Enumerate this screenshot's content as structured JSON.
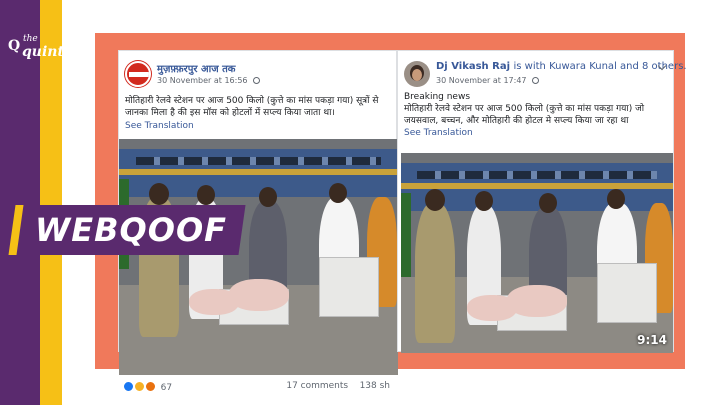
{
  "brand": {
    "logo_prefix": "the",
    "logo_name": "quint",
    "logo_mark": "Q"
  },
  "badge": {
    "label": "WEBQOOF"
  },
  "colors": {
    "purple": "#5a2a6e",
    "yellow": "#f6c016",
    "frame": "#f0795b",
    "fb_link": "#385898"
  },
  "posts": [
    {
      "author": "मुज़फ़्फ़रपुर आज तक",
      "timestamp": "30 November at 16:56",
      "text": "मोतिहारी रेलवे स्टेशन पर आज 500 किलो (कुत्ते का मांस पकड़ा गया) सूत्रों से जानका मिला है की इस मॉस को होटलों में सप्ल्य किया जाता था।",
      "translate_link": "See Translation",
      "reaction_count": "67",
      "comments": "17 comments",
      "shares": "138 sh"
    },
    {
      "author": "Dj Vikash Raj",
      "author_rest": "is with Kuwara Kunal and 8 others.",
      "timestamp": "30 November at 17:47",
      "text_line1": "Breaking news",
      "text": "मोतिहारी रेलवे स्टेशन पर आज 500 किलो (कुत्ते का मांस पकड़ा गया) जो जयसवाल, बच्चन, और मोतिहारी की होटल मे सप्ल्य किया जा रहा था",
      "translate_link": "See Translation",
      "video_time": "9:14"
    }
  ],
  "icons": [
    "globe-icon",
    "chevron-down-icon",
    "like-reaction-icon",
    "haha-reaction-icon",
    "angry-reaction-icon"
  ]
}
